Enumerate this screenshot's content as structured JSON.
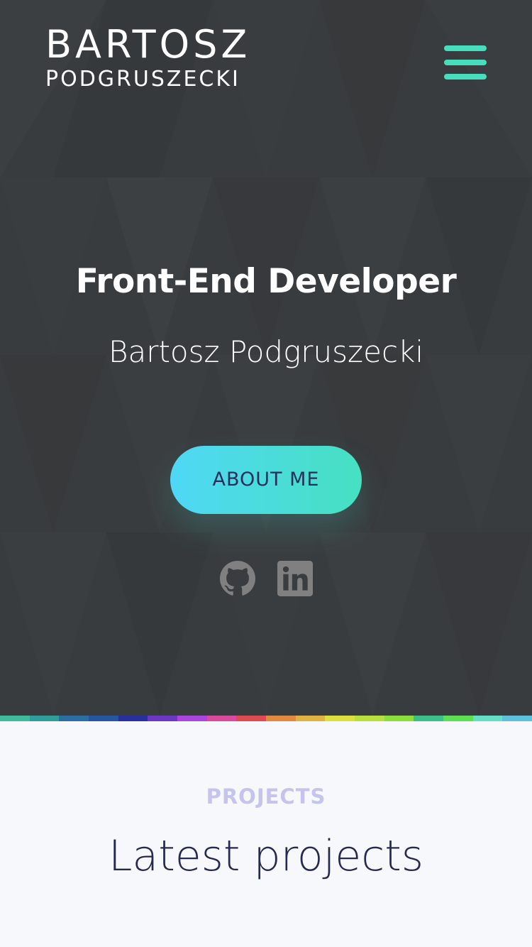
{
  "header": {
    "logo_first": "BARTOSZ",
    "logo_last": "PODGRUSZECKI",
    "menu_icon": "hamburger-menu-icon"
  },
  "hero": {
    "title": "Front-End Developer",
    "name": "Bartosz Podgruszecki",
    "cta_label": "ABOUT ME",
    "social": [
      {
        "icon": "github-icon"
      },
      {
        "icon": "linkedin-icon"
      }
    ]
  },
  "projects": {
    "eyebrow": "PROJECTS",
    "title": "Latest projects"
  },
  "colors": {
    "hero_background": "#393c3e",
    "accent": "#45dfbe",
    "button_gradient_start": "#4fd8f6",
    "button_gradient_end": "#46e0c1",
    "button_text": "#262f5b",
    "social_icon": "#808080",
    "section_background": "#f7f8fb",
    "eyebrow": "#c4c4ec",
    "section_title": "#262950",
    "rainbow_stripe": [
      "#3dbb9a",
      "#2f9d99",
      "#2a6ea3",
      "#2457a0",
      "#2a2fa0",
      "#6b38c4",
      "#ab45de",
      "#d84a9e",
      "#dd4b52",
      "#df8a3e",
      "#e0b23f",
      "#dde03a",
      "#b8e03d",
      "#8adf3c",
      "#3cc08a",
      "#5ddf54",
      "#63dfc4",
      "#5fc0dd"
    ]
  }
}
